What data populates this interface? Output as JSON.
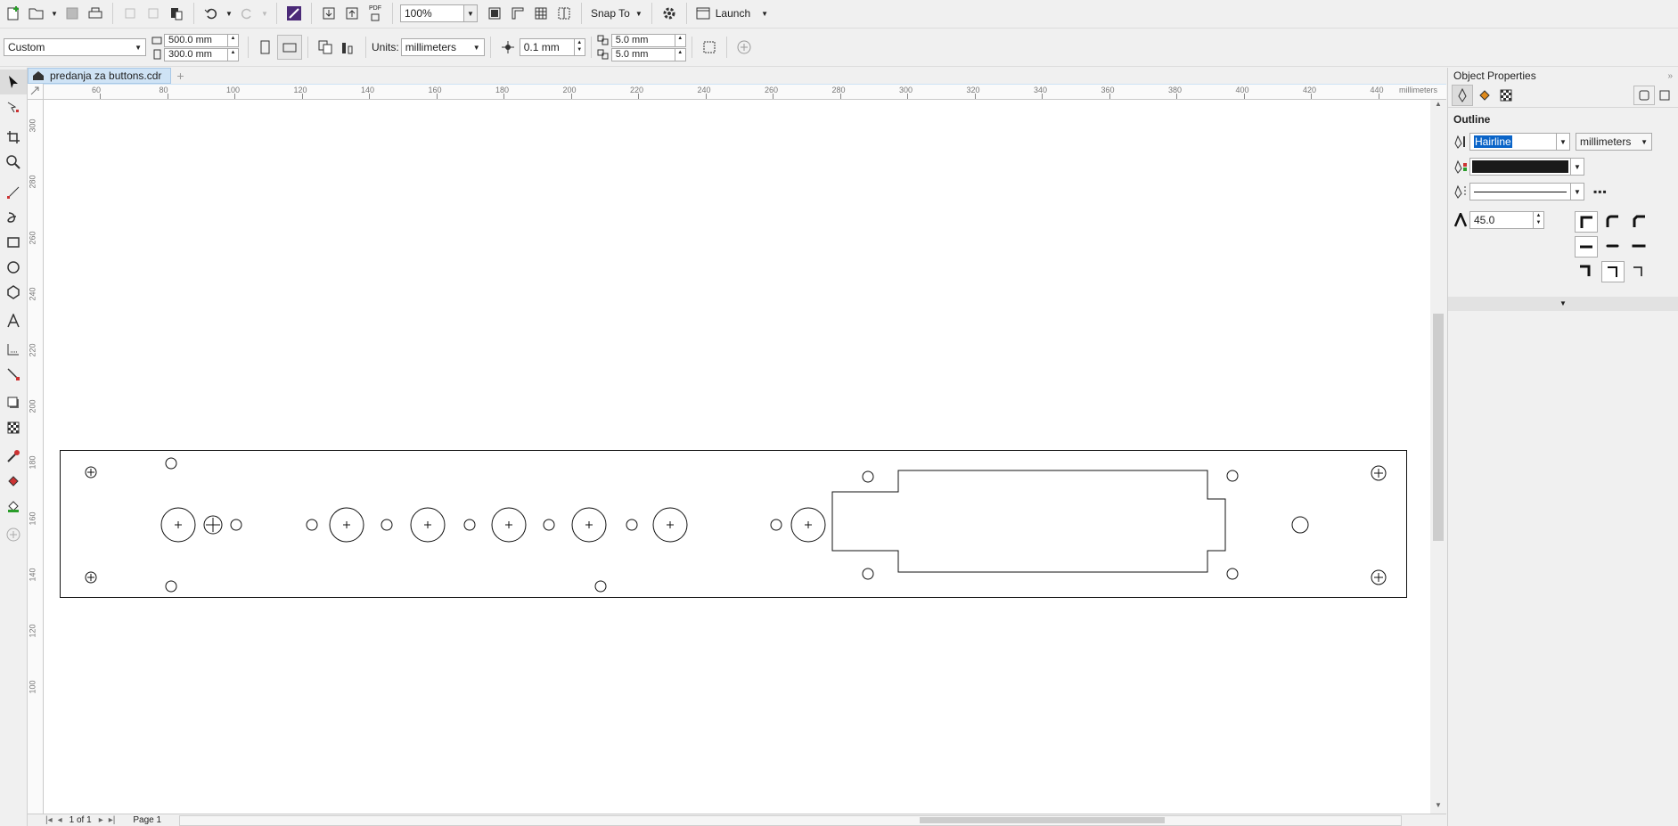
{
  "toolbar": {
    "zoom_value": "100%",
    "snap_label": "Snap To",
    "launch_label": "Launch",
    "pdf_label": "PDF"
  },
  "property_bar": {
    "page_size": "Custom",
    "width": "500.0 mm",
    "height": "300.0 mm",
    "units_label": "Units:",
    "units_value": "millimeters",
    "nudge": "0.1 mm",
    "dup_x": "5.0 mm",
    "dup_y": "5.0 mm"
  },
  "document": {
    "tab_name": "predanja za buttons.cdr",
    "ruler_units": "millimeters",
    "h_ticks": [
      "60",
      "80",
      "100",
      "120",
      "140",
      "160",
      "180",
      "200",
      "220",
      "240",
      "260",
      "280",
      "300",
      "320",
      "340",
      "360",
      "380",
      "400",
      "420",
      "440"
    ],
    "v_ticks": [
      "300",
      "280",
      "260",
      "240",
      "220",
      "200",
      "180",
      "160",
      "140",
      "120",
      "100"
    ]
  },
  "object_properties": {
    "title": "Object Properties",
    "section": "Outline",
    "outline_width": "Hairline",
    "outline_units": "millimeters",
    "miter_limit": "45.0",
    "colors": {
      "outline_color": "#1a1a1a",
      "accent": "#0a64c8"
    }
  },
  "status": {
    "page_info": "1 of 1",
    "page_label": "Page 1"
  }
}
